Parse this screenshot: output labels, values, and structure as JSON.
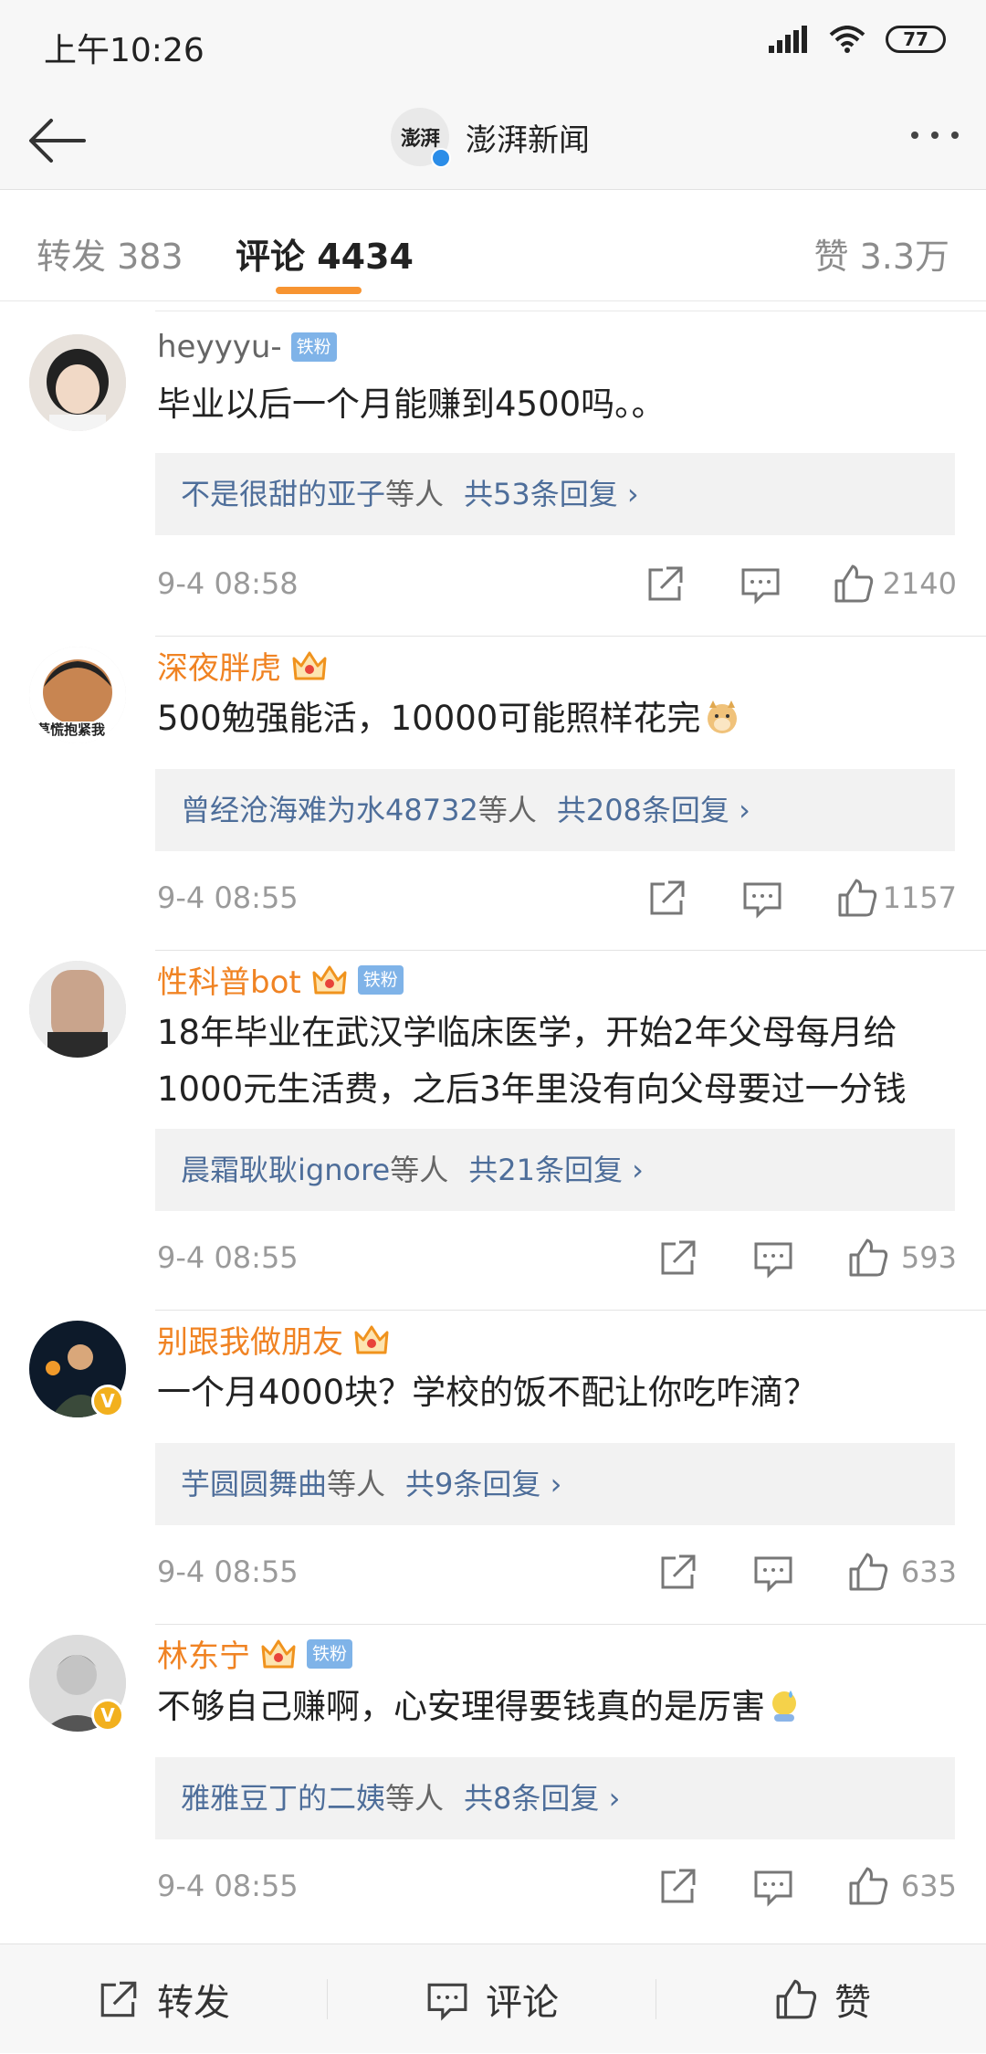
{
  "status_bar": {
    "time": "上午10:26",
    "battery": "77"
  },
  "nav": {
    "account_name": "澎湃新闻",
    "logo_text": "澎湃"
  },
  "tabs": [
    {
      "label": "转发 383"
    },
    {
      "label": "评论 4434"
    },
    {
      "label": "赞 3.3万"
    }
  ],
  "comments": [
    {
      "user": "heyyyu-",
      "fan_badge": "铁粉",
      "text": "毕业以后一个月能赚到4500吗。。",
      "reply_people": "不是很甜的亚子",
      "reply_suffix": "等人",
      "reply_count": "共53条回复 ›",
      "date": "9-4 08:58",
      "likes": "2140"
    },
    {
      "user": "深夜胖虎",
      "text": "500勉强能活，10000可能照样花完",
      "reply_people": "曾经沧海难为水48732",
      "reply_suffix": "等人",
      "reply_count": "共208条回复 ›",
      "date": "9-4 08:55",
      "likes": "1157",
      "avatar_caption": "莫慌抱紧我"
    },
    {
      "user": "性科普bot",
      "fan_badge": "铁粉",
      "text": "18年毕业在武汉学临床医学，开始2年父母每月给1000元生活费，之后3年里没有向父母要过一分钱",
      "reply_people": "晨霜耿耿ignore",
      "reply_suffix": "等人",
      "reply_count": "共21条回复 ›",
      "date": "9-4 08:55",
      "likes": "593"
    },
    {
      "user": "别跟我做朋友",
      "text": "一个月4000块？学校的饭不配让你吃咋滴？",
      "reply_people": "芋圆圆舞曲",
      "reply_suffix": "等人",
      "reply_count": "共9条回复 ›",
      "date": "9-4 08:55",
      "likes": "633"
    },
    {
      "user": "林东宁",
      "fan_badge": "铁粉",
      "text": "不够自己赚啊，心安理得要钱真的是厉害",
      "reply_people": "雅雅豆丁的二姨",
      "reply_suffix": "等人",
      "reply_count": "共8条回复 ›",
      "date": "9-4 08:55",
      "likes": "635"
    }
  ],
  "bottom_bar": {
    "repost": "转发",
    "comment": "评论",
    "like": "赞"
  },
  "colors": {
    "accent": "#f79431",
    "username_orange": "#f08323",
    "link_blue": "#4e6e9a",
    "fan_badge": "#7fb3e8"
  }
}
